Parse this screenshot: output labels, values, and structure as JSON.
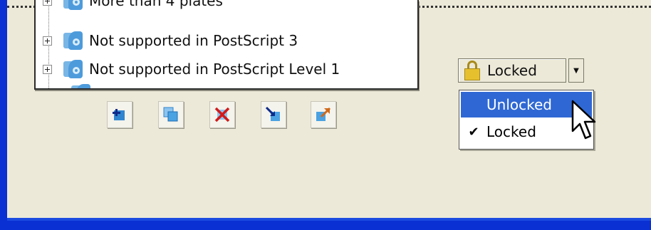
{
  "tree": {
    "items": [
      {
        "label": "More than 4 plates"
      },
      {
        "label": "Not supported in PostScript 3"
      },
      {
        "label": "Not supported in PostScript Level 1"
      }
    ]
  },
  "toolbar": {
    "buttons": [
      {
        "icon": "new-plate-icon"
      },
      {
        "icon": "duplicate-plate-icon"
      },
      {
        "icon": "delete-icon"
      },
      {
        "icon": "import-icon"
      },
      {
        "icon": "export-icon"
      }
    ]
  },
  "lock": {
    "selected": "Locked",
    "icon": "lock-icon",
    "options": [
      {
        "label": "Unlocked",
        "checked": false,
        "highlighted": true
      },
      {
        "label": "Locked",
        "checked": true,
        "highlighted": false
      }
    ],
    "check_mark": "✔"
  },
  "colors": {
    "window_frame": "#0a2fd2",
    "face": "#ece9d8",
    "highlight": "#2f68d4"
  }
}
